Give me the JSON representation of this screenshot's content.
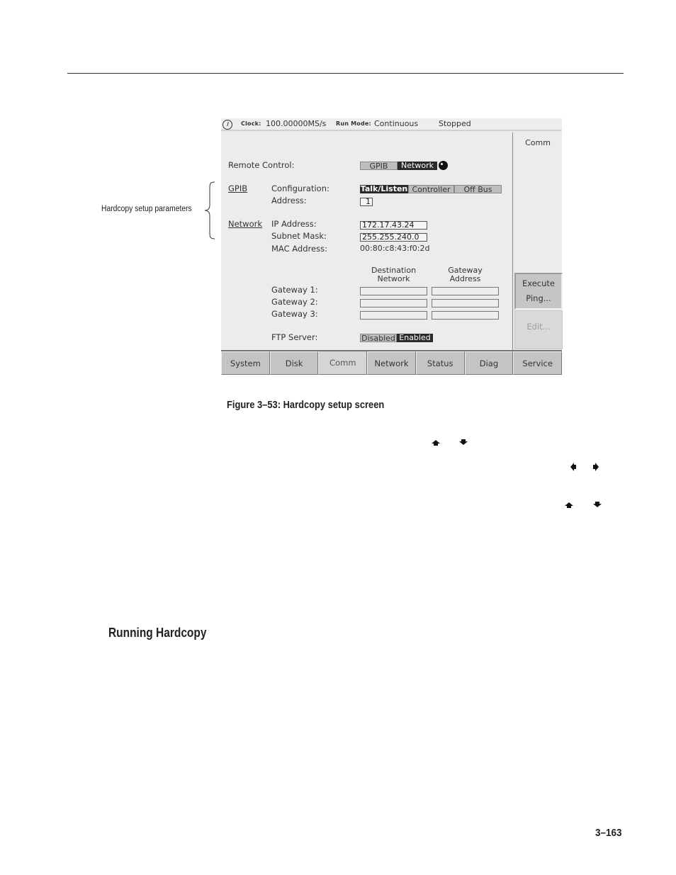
{
  "callout": {
    "label": "Hardcopy setup parameters"
  },
  "screen": {
    "status_bar": {
      "clock_label": "Clock:",
      "clock_value": "100.00000MS/s",
      "run_mode_label": "Run Mode:",
      "run_mode_value": "Continuous",
      "state": "Stopped"
    },
    "side_panel": {
      "title": "Comm",
      "execute_label_1": "Execute",
      "execute_label_2": "Ping...",
      "edit_label": "Edit..."
    },
    "remote_control": {
      "label": "Remote Control:",
      "options": [
        "GPIB",
        "Network"
      ],
      "selected": "Network"
    },
    "gpib": {
      "section_label": "GPIB",
      "configuration_label": "Configuration:",
      "configuration_options": [
        "Talk/Listen",
        "Controller",
        "Off Bus"
      ],
      "configuration_selected": "Talk/Listen",
      "address_label": "Address:",
      "address_value": "1"
    },
    "network": {
      "section_label": "Network",
      "ip_label": "IP Address:",
      "ip_value": "172.17.43.24",
      "subnet_label": "Subnet Mask:",
      "subnet_value": "255.255.240.0",
      "mac_label": "MAC Address:",
      "mac_value": "00:80:c8:43:f0:2d"
    },
    "gateways": {
      "col_dest_1": "Destination",
      "col_dest_2": "Network",
      "col_gw_1": "Gateway",
      "col_gw_2": "Address",
      "rows": [
        {
          "label": "Gateway 1:",
          "destination": "",
          "address": ""
        },
        {
          "label": "Gateway 2:",
          "destination": "",
          "address": ""
        },
        {
          "label": "Gateway 3:",
          "destination": "",
          "address": ""
        }
      ]
    },
    "ftp": {
      "label": "FTP Server:",
      "options": [
        "Disabled",
        "Enabled"
      ],
      "selected": "Enabled"
    },
    "tabs": [
      {
        "label": "System"
      },
      {
        "label": "Disk"
      },
      {
        "label": "Comm",
        "active": true
      },
      {
        "label": "Network"
      },
      {
        "label": "Status"
      },
      {
        "label": "Diag"
      },
      {
        "label": "Service"
      }
    ]
  },
  "figure_caption": "Figure 3–53: Hardcopy setup screen",
  "arrow_icons": [
    "up-arrow-icon",
    "down-arrow-icon",
    "left-arrow-icon",
    "right-arrow-icon",
    "up-arrow-icon",
    "down-arrow-icon"
  ],
  "section_heading": "Running Hardcopy",
  "page_number": "3–163"
}
